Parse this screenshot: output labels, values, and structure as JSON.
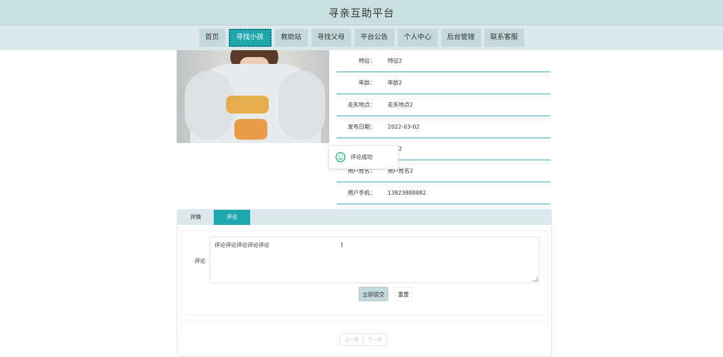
{
  "header": {
    "title": "寻亲互助平台"
  },
  "nav": {
    "items": [
      {
        "label": "首页",
        "active": false
      },
      {
        "label": "寻找小孩",
        "active": true
      },
      {
        "label": "救助站",
        "active": false
      },
      {
        "label": "寻找父母",
        "active": false
      },
      {
        "label": "平台公告",
        "active": false
      },
      {
        "label": "个人中心",
        "active": false
      },
      {
        "label": "后台管理",
        "active": false
      },
      {
        "label": "联系客服",
        "active": false
      }
    ]
  },
  "details": {
    "rows": [
      {
        "label": "特征：",
        "value": "特征2"
      },
      {
        "label": "年龄：",
        "value": "年龄2"
      },
      {
        "label": "走失地点：",
        "value": "走失地点2"
      },
      {
        "label": "发布日期：",
        "value": "2022-03-02"
      },
      {
        "label": "",
        "value": "账号2"
      },
      {
        "label": "用户姓名：",
        "value": "用户姓名2"
      },
      {
        "label": "用户手机：",
        "value": "13823888882"
      }
    ]
  },
  "toast": {
    "message": "评论成功",
    "icon": "smile-icon",
    "color": "#22b07a"
  },
  "tabs": [
    {
      "label": "详情",
      "active": false
    },
    {
      "label": "评论",
      "active": true
    }
  ],
  "comment_form": {
    "label": "评论",
    "value": "评论评论评论评论评论",
    "submit_label": "立即提交",
    "reset_label": "重置"
  },
  "pagination": {
    "prev": "上一页",
    "next": "下一页"
  },
  "colors": {
    "accent": "#20a6ad",
    "nav_bg": "#dbe8ec",
    "header_bg": "#c9dfe0"
  }
}
